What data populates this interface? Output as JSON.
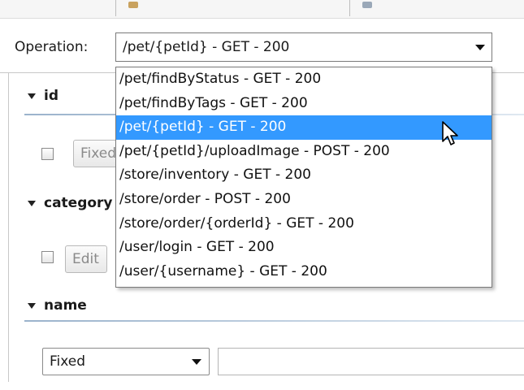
{
  "operation": {
    "label": "Operation:",
    "selected": "/pet/{petId} - GET - 200",
    "options": [
      "/pet/findByStatus - GET - 200",
      "/pet/findByTags - GET - 200",
      "/pet/{petId} - GET - 200",
      "/pet/{petId}/uploadImage - POST - 200",
      "/store/inventory - GET - 200",
      "/store/order - POST - 200",
      "/store/order/{orderId} - GET - 200",
      "/user/login - GET - 200",
      "/user/{username} - GET - 200"
    ],
    "highlighted_index": 2
  },
  "sections": {
    "id": {
      "title": "id",
      "mode_button": "Fixed"
    },
    "category": {
      "title": "category",
      "mode_button": "Edit"
    },
    "name": {
      "title": "name",
      "mode_select": "Fixed",
      "value": ""
    }
  },
  "icons": {
    "collapse": "triangle-down-icon",
    "dropdown": "chevron-down-icon",
    "cursor": "mouse-pointer-icon"
  },
  "colors": {
    "selection": "#3399ff",
    "section_rule": "#9bb3cc"
  }
}
